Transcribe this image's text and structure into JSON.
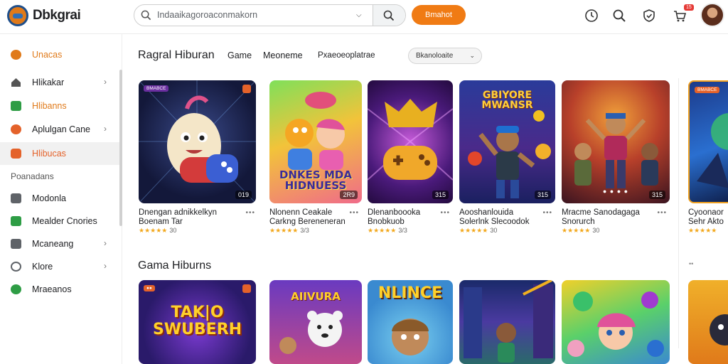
{
  "header": {
    "brand": "Dbkgrai",
    "search_placeholder": "Indaaikagoroaconmakorn",
    "cta_label": "Bmahot",
    "notification_count": "15"
  },
  "sidebar": {
    "items": [
      {
        "label": "Unacas",
        "icon": "home-orange-icon",
        "color": "#e07a1a",
        "arrow": false
      },
      {
        "label": "Hlikakar",
        "icon": "home-icon",
        "color": "#5f6368",
        "arrow": true
      },
      {
        "label": "Hlibanns",
        "icon": "green-tile-icon",
        "color": "#2e9d45",
        "arrow": false
      },
      {
        "label": "Aplulgan Cane",
        "icon": "orange-badge-icon",
        "color": "#e4622a",
        "arrow": true
      },
      {
        "label": "Hlibucas",
        "icon": "orange-flame-icon",
        "color": "#e4622a",
        "arrow": false,
        "active": true
      }
    ],
    "section_label": "Poanadans",
    "items2": [
      {
        "label": "Modonla",
        "icon": "bag-icon",
        "color": "#5f6368",
        "arrow": false
      },
      {
        "label": "Mealder Cnories",
        "icon": "green-check-icon",
        "color": "#2e9d45",
        "arrow": false
      },
      {
        "label": "Mcaneang",
        "icon": "folder-icon",
        "color": "#5f6368",
        "arrow": true
      },
      {
        "label": "Klore",
        "icon": "compass-icon",
        "color": "#5f6368",
        "arrow": true
      },
      {
        "label": "Mraeanos",
        "icon": "green-leaf-icon",
        "color": "#2e9d45",
        "arrow": false
      }
    ]
  },
  "main": {
    "section1_title": "Ragral Hiburan",
    "chips": [
      "Game",
      "Meoneme",
      "Pxaeoeoplatrae"
    ],
    "dropdown_value": "Bkanoloaite",
    "section2_title": "Gama Hiburns",
    "row1": [
      {
        "line1": "Dnengan adnikkelkyn",
        "line2": "Boenam Tar",
        "rating": "★★★★★",
        "rating_num": "30",
        "badge": "019",
        "tag": "BMABCE"
      },
      {
        "line1": "Nlonenn Ceakale",
        "line2": "Carkng Bereneneran",
        "rating": "★★★★★",
        "rating_num": "3/3",
        "badge": "2R9",
        "cover_text": "DNKES MDA HIDNUESS"
      },
      {
        "line1": "Dlenanboooka",
        "line2": "Bnobkuob",
        "rating": "★★★★★",
        "rating_num": "3/3",
        "badge": "315"
      },
      {
        "line1": "Aooshanlouida",
        "line2": "Solerlnk Slecoodok",
        "rating": "★★★★★",
        "rating_num": "30",
        "badge": "315",
        "cover_text": "GBIYORE MWANSR"
      },
      {
        "line1": "Mracme Sanodagaga",
        "line2": "Snorurch",
        "rating": "★★★★★",
        "rating_num": "30",
        "badge": "315"
      },
      {
        "line1": "Cyoonaor",
        "line2": "Sehr Akto",
        "rating": "★★★★★",
        "rating_num": "",
        "badge": "",
        "tag": "BMABCE"
      }
    ],
    "row2": [
      {
        "cover_text": "TAK|O SWUBERH"
      },
      {
        "cover_text": "AIIVURA"
      },
      {
        "cover_text": "NLINCE"
      },
      {
        "cover_text": ""
      },
      {
        "cover_text": ""
      },
      {
        "cover_text": ""
      }
    ]
  },
  "colors": {
    "accent_orange": "#f07b14",
    "star": "#f2a81d"
  }
}
